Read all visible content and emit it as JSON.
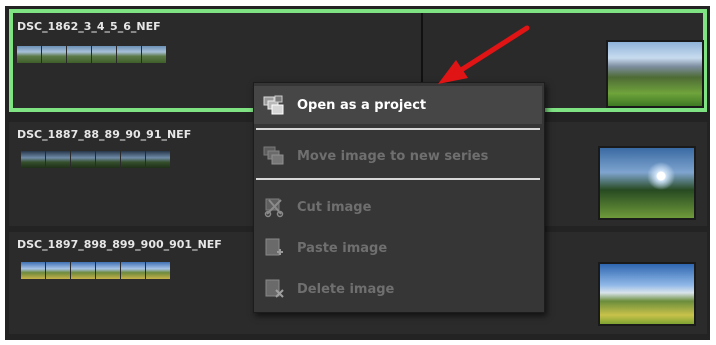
{
  "series": [
    {
      "title": "DSC_1862_3_4_5_6_NEF",
      "selected": true,
      "thumb_count": 6
    },
    {
      "title": "DSC_1887_88_89_90_91_NEF",
      "selected": false,
      "thumb_count": 6
    },
    {
      "title": "DSC_1897_898_899_900_901_NEF",
      "selected": false,
      "thumb_count": 6
    }
  ],
  "context_menu": {
    "items": [
      {
        "label": "Open as a project",
        "icon": "open-project-icon",
        "enabled": true,
        "highlighted": true
      },
      {
        "label": "Move image to new series",
        "icon": "move-series-icon",
        "enabled": false
      },
      {
        "label": "Cut image",
        "icon": "scissors-icon",
        "enabled": false
      },
      {
        "label": "Paste image",
        "icon": "paste-icon",
        "enabled": false
      },
      {
        "label": "Delete image",
        "icon": "delete-icon",
        "enabled": false
      }
    ]
  },
  "colors": {
    "selection_border": "#7fe383",
    "annotation_arrow": "#e01414",
    "menu_background": "#363636",
    "disabled_text": "#6f6f6f"
  }
}
